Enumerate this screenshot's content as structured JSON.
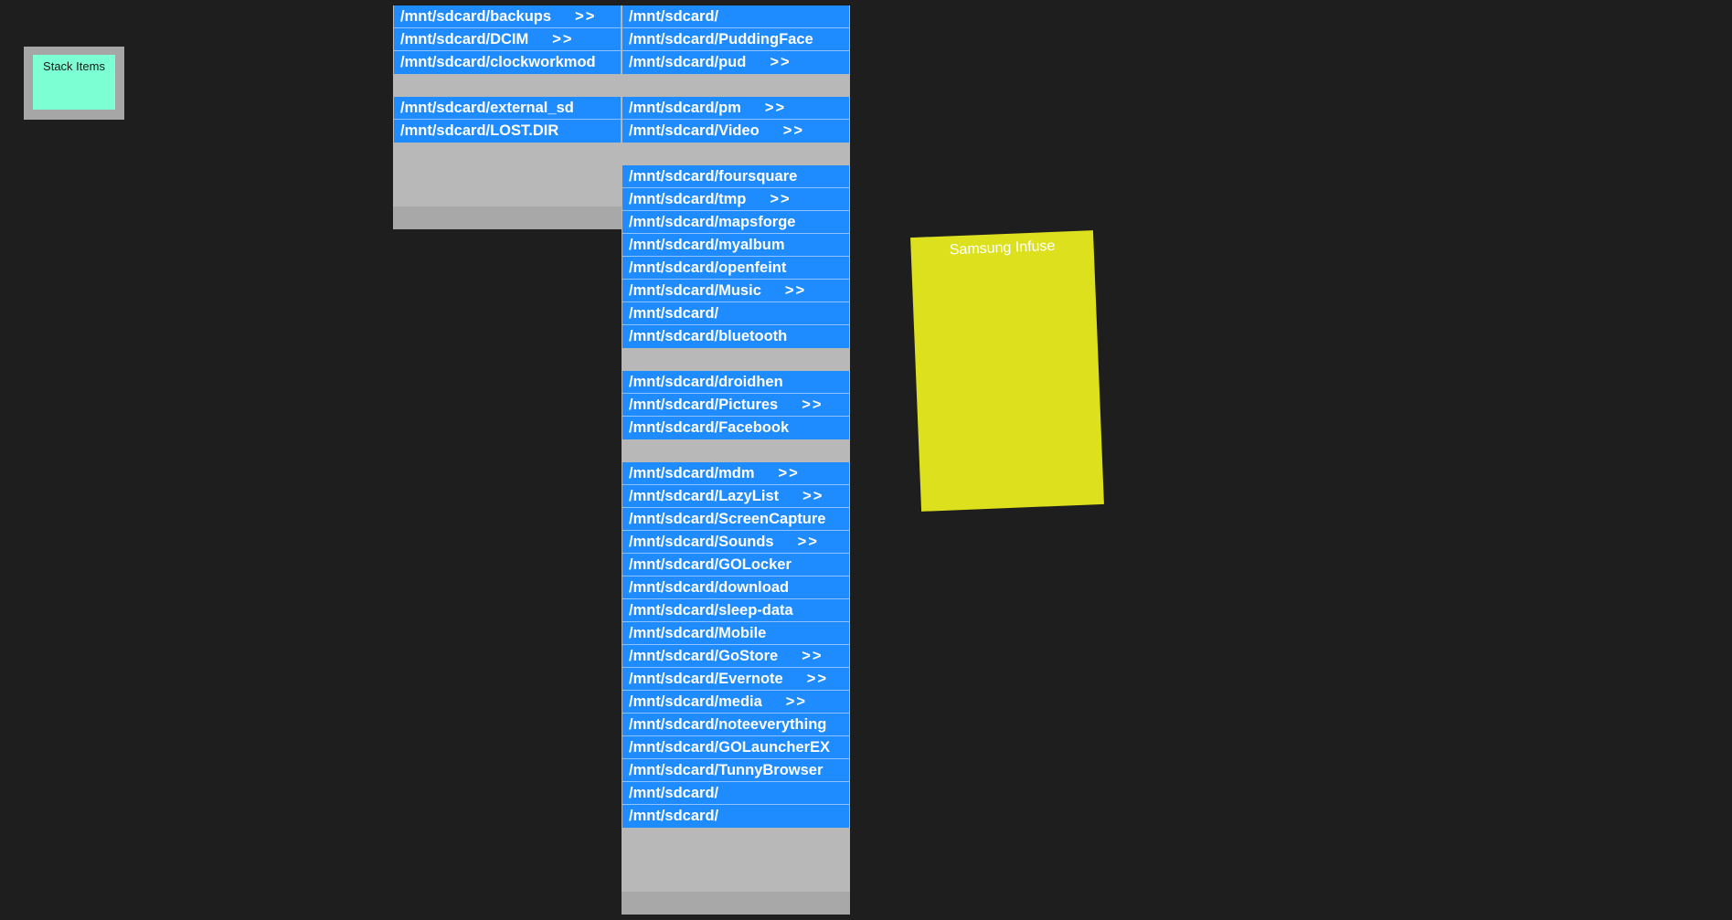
{
  "stack_widget": {
    "label": "Stack Items"
  },
  "device_card": {
    "label": "Samsung Infuse",
    "color": "#dde01d"
  },
  "colors": {
    "background": "#1e1e1e",
    "row": "#1e8bff",
    "column": "#b8b8b8",
    "stack_border": "#a6a6a6",
    "stack_fill": "#7dffd4"
  },
  "left_column": {
    "groups": [
      {
        "rows": [
          {
            "label": "/mnt/sdcard/backups",
            "arrow": ">>"
          },
          {
            "label": "/mnt/sdcard/DCIM",
            "arrow": ">>"
          },
          {
            "label": "/mnt/sdcard/clockworkmod",
            "arrow": ""
          }
        ]
      },
      {
        "rows": [
          {
            "label": "/mnt/sdcard/external_sd",
            "arrow": ""
          },
          {
            "label": "/mnt/sdcard/LOST.DIR",
            "arrow": ""
          }
        ]
      }
    ]
  },
  "right_column": {
    "groups": [
      {
        "rows": [
          {
            "label": "/mnt/sdcard/",
            "arrow": ""
          },
          {
            "label": "/mnt/sdcard/PuddingFace",
            "arrow": ""
          },
          {
            "label": "/mnt/sdcard/pud",
            "arrow": ">>"
          }
        ]
      },
      {
        "rows": [
          {
            "label": "/mnt/sdcard/pm",
            "arrow": ">>"
          },
          {
            "label": "/mnt/sdcard/Video",
            "arrow": ">>"
          }
        ]
      },
      {
        "rows": [
          {
            "label": "/mnt/sdcard/foursquare",
            "arrow": ""
          },
          {
            "label": "/mnt/sdcard/tmp",
            "arrow": ">>"
          },
          {
            "label": "/mnt/sdcard/mapsforge",
            "arrow": ""
          },
          {
            "label": "/mnt/sdcard/myalbum",
            "arrow": ""
          },
          {
            "label": "/mnt/sdcard/openfeint",
            "arrow": ""
          },
          {
            "label": "/mnt/sdcard/Music",
            "arrow": ">>"
          },
          {
            "label": "/mnt/sdcard/",
            "arrow": ""
          },
          {
            "label": "/mnt/sdcard/bluetooth",
            "arrow": ""
          }
        ]
      },
      {
        "rows": [
          {
            "label": "/mnt/sdcard/droidhen",
            "arrow": ""
          },
          {
            "label": "/mnt/sdcard/Pictures",
            "arrow": ">>"
          },
          {
            "label": "/mnt/sdcard/Facebook",
            "arrow": ""
          }
        ]
      },
      {
        "rows": [
          {
            "label": "/mnt/sdcard/mdm",
            "arrow": ">>"
          },
          {
            "label": "/mnt/sdcard/LazyList",
            "arrow": ">>"
          },
          {
            "label": "/mnt/sdcard/ScreenCapture",
            "arrow": ""
          },
          {
            "label": "/mnt/sdcard/Sounds",
            "arrow": ">>"
          },
          {
            "label": "/mnt/sdcard/GOLocker",
            "arrow": ""
          },
          {
            "label": "/mnt/sdcard/download",
            "arrow": ""
          },
          {
            "label": "/mnt/sdcard/sleep-data",
            "arrow": ""
          },
          {
            "label": "/mnt/sdcard/Mobile",
            "arrow": ""
          },
          {
            "label": "/mnt/sdcard/GoStore",
            "arrow": ">>"
          },
          {
            "label": "/mnt/sdcard/Evernote",
            "arrow": ">>"
          },
          {
            "label": "/mnt/sdcard/media",
            "arrow": ">>"
          },
          {
            "label": "/mnt/sdcard/noteeverything",
            "arrow": ""
          },
          {
            "label": "/mnt/sdcard/GOLauncherEX",
            "arrow": ""
          },
          {
            "label": "/mnt/sdcard/TunnyBrowser",
            "arrow": ""
          },
          {
            "label": "/mnt/sdcard/",
            "arrow": ""
          },
          {
            "label": "/mnt/sdcard/",
            "arrow": ""
          }
        ]
      }
    ]
  }
}
